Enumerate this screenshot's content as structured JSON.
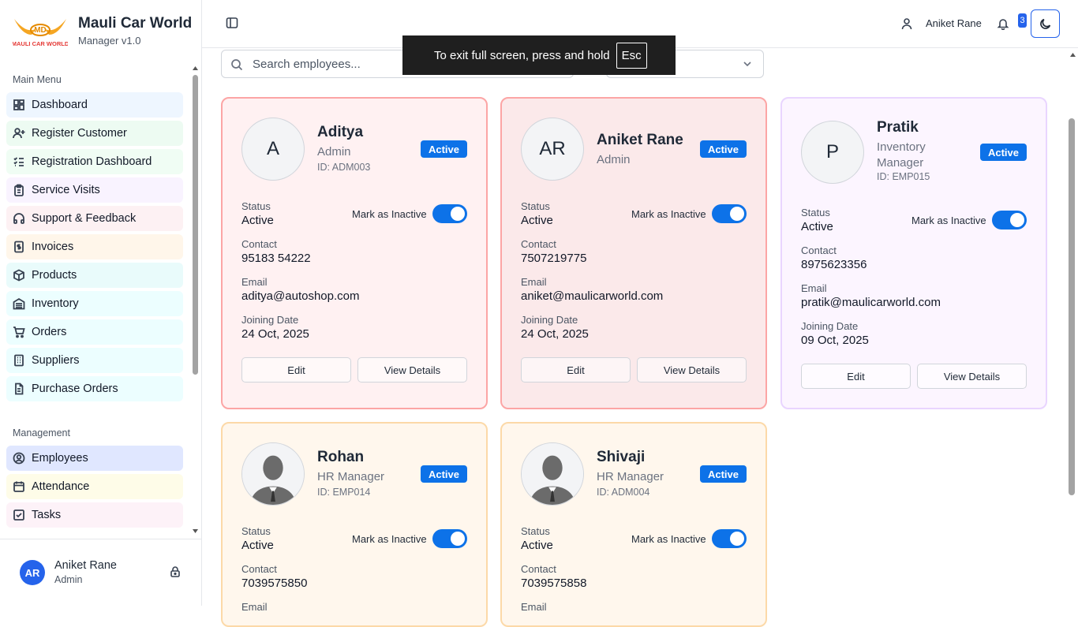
{
  "brand": {
    "title": "Mauli Car World",
    "subtitle": "Manager v1.0",
    "logo_text": "MAULI CAR WORLD",
    "logo_mark": "MD"
  },
  "sidebar": {
    "main_heading": "Main Menu",
    "main_items": [
      {
        "label": "Dashboard",
        "icon": "layout-dashboard-icon",
        "bg": "#eef6ff"
      },
      {
        "label": "Register Customer",
        "icon": "user-plus-icon",
        "bg": "#edfbf2"
      },
      {
        "label": "Registration Dashboard",
        "icon": "list-checks-icon",
        "bg": "#f0fdf4"
      },
      {
        "label": "Service Visits",
        "icon": "clipboard-icon",
        "bg": "#f9f3ff"
      },
      {
        "label": "Support & Feedback",
        "icon": "headphones-icon",
        "bg": "#fdf1f3"
      },
      {
        "label": "Invoices",
        "icon": "receipt-icon",
        "bg": "#fff6ea"
      },
      {
        "label": "Products",
        "icon": "package-icon",
        "bg": "#e9fbfb"
      },
      {
        "label": "Inventory",
        "icon": "warehouse-icon",
        "bg": "#ecfeff"
      },
      {
        "label": "Orders",
        "icon": "cart-icon",
        "bg": "#ecfeff"
      },
      {
        "label": "Suppliers",
        "icon": "building-icon",
        "bg": "#ecfeff"
      },
      {
        "label": "Purchase Orders",
        "icon": "file-text-icon",
        "bg": "#ecfeff"
      }
    ],
    "mgmt_heading": "Management",
    "mgmt_items": [
      {
        "label": "Employees",
        "icon": "user-circle-icon",
        "bg": "#e0e7ff"
      },
      {
        "label": "Attendance",
        "icon": "calendar-icon",
        "bg": "#fefce8"
      },
      {
        "label": "Tasks",
        "icon": "check-square-icon",
        "bg": "#fdf2f8"
      }
    ],
    "user": {
      "initials": "AR",
      "name": "Aniket Rane",
      "role": "Admin"
    }
  },
  "topbar": {
    "user_name": "Aniket Rane",
    "notification_count": "3"
  },
  "search": {
    "placeholder": "Search employees..."
  },
  "fullscreen_notice": {
    "text": "To exit full screen, press and hold",
    "key": "Esc"
  },
  "accent": "#0d72e8",
  "employees": [
    {
      "initials": "A",
      "photo": false,
      "name": "Aditya",
      "role": "Admin",
      "id": "ID: ADM003",
      "badge": "Active",
      "status_label": "Status",
      "status": "Active",
      "toggle_label": "Mark as Inactive",
      "contact_label": "Contact",
      "contact": "95183 54222",
      "email_label": "Email",
      "email": "aditya@autoshop.com",
      "joining_label": "Joining Date",
      "joining": "24 Oct, 2025",
      "edit": "Edit",
      "view": "View Details",
      "bg": "#fff1f2",
      "border": "#fca5a5"
    },
    {
      "initials": "AR",
      "photo": false,
      "name": "Aniket Rane",
      "role": "Admin",
      "id": "",
      "badge": "Active",
      "status_label": "Status",
      "status": "Active",
      "toggle_label": "Mark as Inactive",
      "contact_label": "Contact",
      "contact": "7507219775",
      "email_label": "Email",
      "email": "aniket@maulicarworld.com",
      "joining_label": "Joining Date",
      "joining": "24 Oct, 2025",
      "edit": "Edit",
      "view": "View Details",
      "bg": "#fbe9ea",
      "border": "#fca5a5"
    },
    {
      "initials": "P",
      "photo": false,
      "name": "Pratik",
      "role": "Inventory Manager",
      "id": "ID: EMP015",
      "badge": "Active",
      "status_label": "Status",
      "status": "Active",
      "toggle_label": "Mark as Inactive",
      "contact_label": "Contact",
      "contact": "8975623356",
      "email_label": "Email",
      "email": "pratik@maulicarworld.com",
      "joining_label": "Joining Date",
      "joining": "09 Oct, 2025",
      "edit": "Edit",
      "view": "View Details",
      "bg": "#fcf5ff",
      "border": "#e9d5ff"
    },
    {
      "initials": "",
      "photo": true,
      "name": "Rohan",
      "role": "HR Manager",
      "id": "ID: EMP014",
      "badge": "Active",
      "status_label": "Status",
      "status": "Active",
      "toggle_label": "Mark as Inactive",
      "contact_label": "Contact",
      "contact": "7039575850",
      "email_label": "Email",
      "bg": "#fff7ed",
      "border": "#fcd9a8"
    },
    {
      "initials": "",
      "photo": true,
      "name": "Shivaji",
      "role": "HR Manager",
      "id": "ID: ADM004",
      "badge": "Active",
      "status_label": "Status",
      "status": "Active",
      "toggle_label": "Mark as Inactive",
      "contact_label": "Contact",
      "contact": "7039575858",
      "email_label": "Email",
      "bg": "#fff7ed",
      "border": "#fcd9a8"
    }
  ]
}
